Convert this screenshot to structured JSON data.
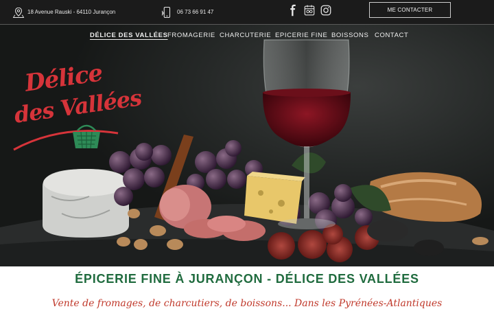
{
  "topbar": {
    "address": "18 Avenue Rauski - 64110 Jurançon",
    "phone": "06 73 66 91 47",
    "socials": [
      {
        "icon": "facebook-icon"
      },
      {
        "icon": "tripadvisor-icon"
      },
      {
        "icon": "instagram-icon"
      }
    ],
    "contact_button": "ME CONTACTER"
  },
  "nav": {
    "items": [
      {
        "label": "DÉLICE DES VALLÉES",
        "active": true
      },
      {
        "label": "FROMAGERIE",
        "active": false
      },
      {
        "label": "CHARCUTERIE",
        "active": false
      },
      {
        "label": "EPICERIE FINE",
        "active": false
      },
      {
        "label": "BOISSONS",
        "active": false
      },
      {
        "label": "CONTACT",
        "active": false
      }
    ]
  },
  "logo": {
    "line1": "Délice",
    "line2": "des Vallées",
    "color": "#d6343a",
    "basket_color": "#2e8b57"
  },
  "main": {
    "title": "ÉPICERIE FINE À JURANÇON - DÉLICE DES VALLÉES",
    "subtitle": "Vente de fromages, de charcutiers, de boissons... Dans les Pyrénées-Atlantiques",
    "title_color": "#1f6b3e",
    "subtitle_color": "#c0392b"
  }
}
